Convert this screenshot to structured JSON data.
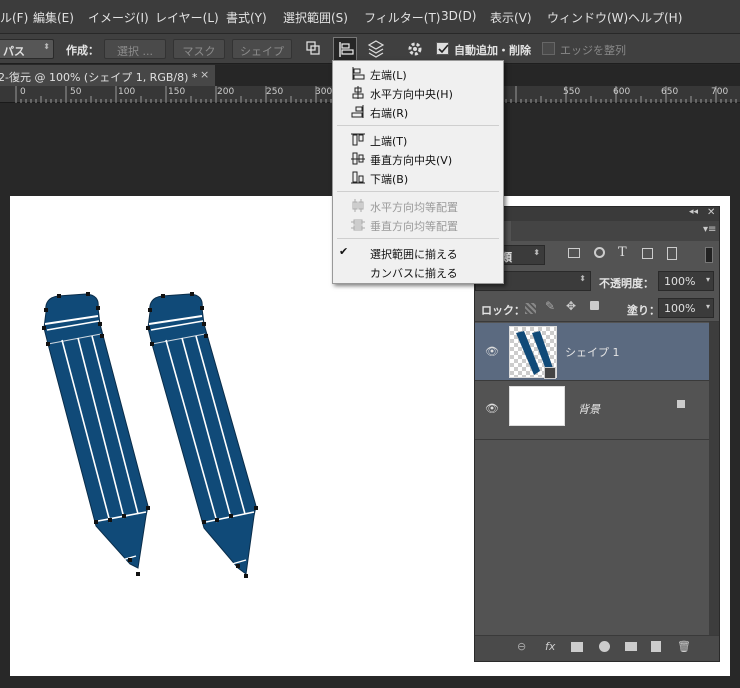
{
  "menubar": {
    "items": [
      "ル(F)",
      "編集(E)",
      "イメージ(I)",
      "レイヤー(L)",
      "書式(Y)",
      "選択範囲(S)",
      "フィルター(T)",
      "3D(D)",
      "表示(V)",
      "ウィンドウ(W)",
      "ヘルプ(H)"
    ]
  },
  "options": {
    "mode_value": "パス",
    "create_label": "作成：",
    "select_button": "選択 ...",
    "mask_button": "マスク",
    "shape_button": "シェイプ",
    "auto_add_delete": "自動追加・削除",
    "align_edges": "エッジを整列"
  },
  "document_tab": {
    "title": "2-復元 @ 100% (シェイプ 1, RGB/8) *",
    "close": "×"
  },
  "ruler": {
    "ticks": [
      "0",
      "50",
      "100",
      "150",
      "200",
      "250",
      "300",
      "550",
      "600",
      "650",
      "700"
    ]
  },
  "align_menu": {
    "items": [
      {
        "label": "左端(L)",
        "icon": "align-left-icon",
        "disabled": false
      },
      {
        "label": "水平方向中央(H)",
        "icon": "align-hcenter-icon",
        "disabled": false
      },
      {
        "label": "右端(R)",
        "icon": "align-right-icon",
        "disabled": false
      },
      {
        "label": "上端(T)",
        "icon": "align-top-icon",
        "disabled": false
      },
      {
        "label": "垂直方向中央(V)",
        "icon": "align-vcenter-icon",
        "disabled": false
      },
      {
        "label": "下端(B)",
        "icon": "align-bottom-icon",
        "disabled": false
      },
      {
        "label": "水平方向均等配置",
        "icon": "distribute-horizontal-icon",
        "disabled": true
      },
      {
        "label": "垂直方向均等配置",
        "icon": "distribute-vertical-icon",
        "disabled": true
      },
      {
        "label": "選択範囲に揃える",
        "icon": "checkmark-icon",
        "checked": true,
        "disabled": false
      },
      {
        "label": "カンバスに揃える",
        "icon": "",
        "disabled": false
      }
    ]
  },
  "layers_panel": {
    "tab_label": "ー",
    "filter_label": "種類",
    "blend_mode": "",
    "opacity_label": "不透明度：",
    "opacity_value": "100%",
    "lock_label": "ロック：",
    "fill_label": "塗り：",
    "fill_value": "100%",
    "layers": [
      {
        "name": "シェイプ 1",
        "active": true
      },
      {
        "name": "背景",
        "active": false,
        "locked": true
      }
    ],
    "footer_icons": [
      "link-icon",
      "fx-icon",
      "mask-icon",
      "adjustment-icon",
      "folder-icon",
      "new-layer-icon",
      "trash-icon"
    ],
    "fx_label": "fx"
  },
  "colors": {
    "pencil_fill": "#104a78",
    "menu_bg": "#f0f0f0",
    "panel_bg": "#535353",
    "active_layer": "#5b6a80"
  }
}
